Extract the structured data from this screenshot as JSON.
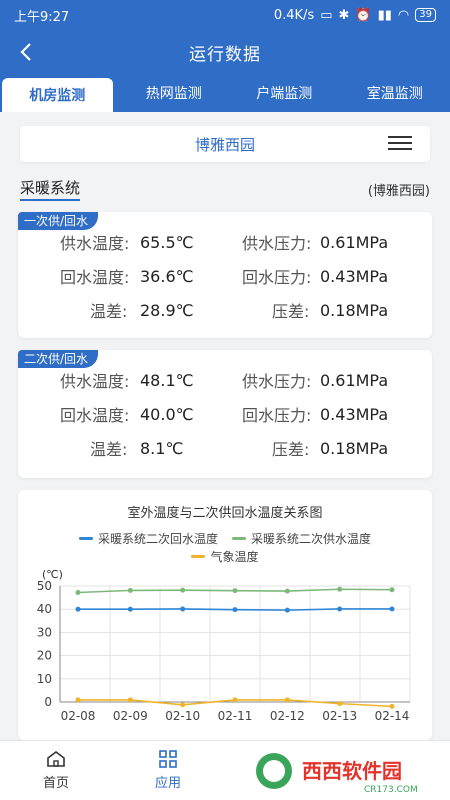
{
  "status": {
    "time": "上午9:27",
    "speed": "0.4K/s",
    "battery": "39"
  },
  "header": {
    "title": "运行数据"
  },
  "tabs": [
    {
      "label": "机房监测",
      "active": true
    },
    {
      "label": "热网监测",
      "active": false
    },
    {
      "label": "户端监测",
      "active": false
    },
    {
      "label": "室温监测",
      "active": false
    }
  ],
  "site": {
    "name": "博雅西园"
  },
  "section": {
    "title": "采暖系统",
    "site_tag": "(博雅西园)"
  },
  "primary": {
    "label": "一次供/回水",
    "supply_temp_label": "供水温度:",
    "supply_temp": "65.5℃",
    "supply_press_label": "供水压力:",
    "supply_press": "0.61MPa",
    "return_temp_label": "回水温度:",
    "return_temp": "36.6℃",
    "return_press_label": "回水压力:",
    "return_press": "0.43MPa",
    "temp_diff_label": "温差:",
    "temp_diff": "28.9℃",
    "press_diff_label": "压差:",
    "press_diff": "0.18MPa"
  },
  "secondary": {
    "label": "二次供/回水",
    "supply_temp_label": "供水温度:",
    "supply_temp": "48.1℃",
    "supply_press_label": "供水压力:",
    "supply_press": "0.61MPa",
    "return_temp_label": "回水温度:",
    "return_temp": "40.0℃",
    "return_press_label": "回水压力:",
    "return_press": "0.43MPa",
    "temp_diff_label": "温差:",
    "temp_diff": "8.1℃",
    "press_diff_label": "压差:",
    "press_diff": "0.18MPa"
  },
  "chart_data": {
    "type": "line",
    "title": "室外温度与二次供回水温度关系图",
    "ylabel": "(℃)",
    "x": [
      "02-08",
      "02-09",
      "02-10",
      "02-11",
      "02-12",
      "02-13",
      "02-14"
    ],
    "ylim": [
      0,
      50
    ],
    "yticks": [
      0,
      10,
      20,
      30,
      40,
      50
    ],
    "grid": true,
    "series": [
      {
        "name": "采暖系统二次回水温度",
        "color": "#2e86d6",
        "values": [
          40,
          40,
          40.1,
          39.8,
          39.6,
          40.1,
          40.1
        ]
      },
      {
        "name": "采暖系统二次供水温度",
        "color": "#7cb87a",
        "values": [
          47.2,
          48.1,
          48.2,
          48,
          47.8,
          48.6,
          48.4
        ]
      },
      {
        "name": "气象温度",
        "color": "#f0b42a",
        "values": [
          0.9,
          0.9,
          -1.2,
          0.9,
          0.9,
          -0.7,
          -1.9
        ]
      }
    ]
  },
  "nav": [
    {
      "label": "首页",
      "icon": "home-icon",
      "active": false
    },
    {
      "label": "应用",
      "icon": "grid-icon",
      "active": true
    }
  ],
  "watermark": {
    "text": "西西软件园",
    "sub": "CR173.COM"
  }
}
